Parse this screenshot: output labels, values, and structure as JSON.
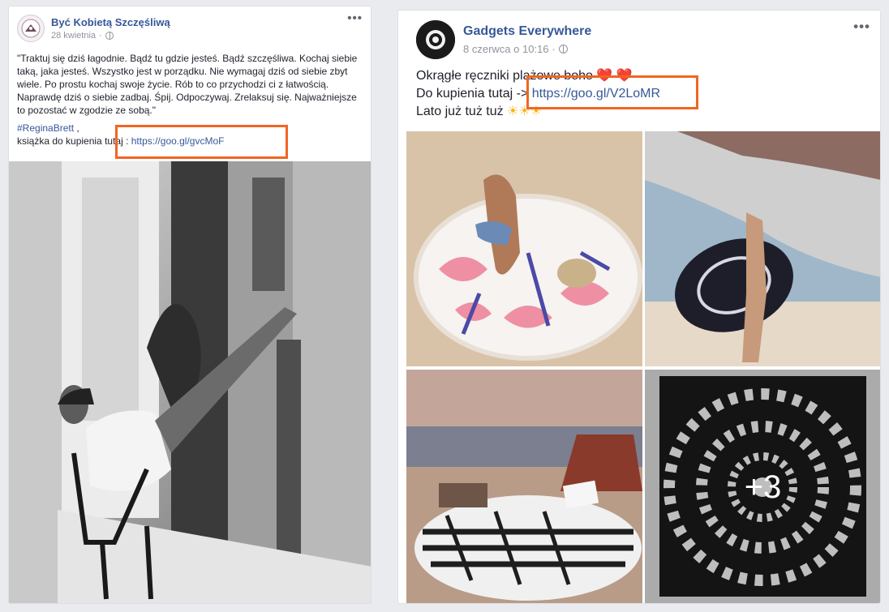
{
  "post1": {
    "page_name": "Być Kobietą Szczęśliwą",
    "date": "28 kwietnia",
    "menu_label": "•••",
    "quote": "\"Traktuj się dziś łagodnie. Bądź tu gdzie jesteś. Bądź szczęśliwa. Kochaj siebie taką, jaka jesteś. Wszystko jest w porządku. Nie wymagaj dziś od siebie zbyt wiele. Po prostu kochaj swoje życie. Rób to co przychodzi ci z łatwością. Naprawdę dziś o siebie zadbaj. Śpij. Odpoczywaj. Zrelaksuj się. Najważniejsze to pozostać w zgodzie ze sobą.\"",
    "hashtag": "#ReginaBrett",
    "hashtag_suffix": " ,",
    "buy_prefix": "książka do kupienia tutaj : ",
    "buy_link": "https://goo.gl/gvcMoF"
  },
  "post2": {
    "page_name": "Gadgets Everywhere",
    "date": "8 czerwca o 10:16",
    "menu_label": "•••",
    "line1": "Okrągłe ręczniki plażowe boho ",
    "line1_icons": "❤️ ❤️",
    "buy_prefix": "Do kupienia tutaj -> ",
    "buy_link": "https://goo.gl/V2LoMR",
    "line3": "Lato już tuż tuż ",
    "line3_icons": "☀☀☀",
    "more_photos": "+3"
  },
  "colors": {
    "highlight": "#f26522",
    "link": "#365899",
    "background": "#e9ebee"
  }
}
